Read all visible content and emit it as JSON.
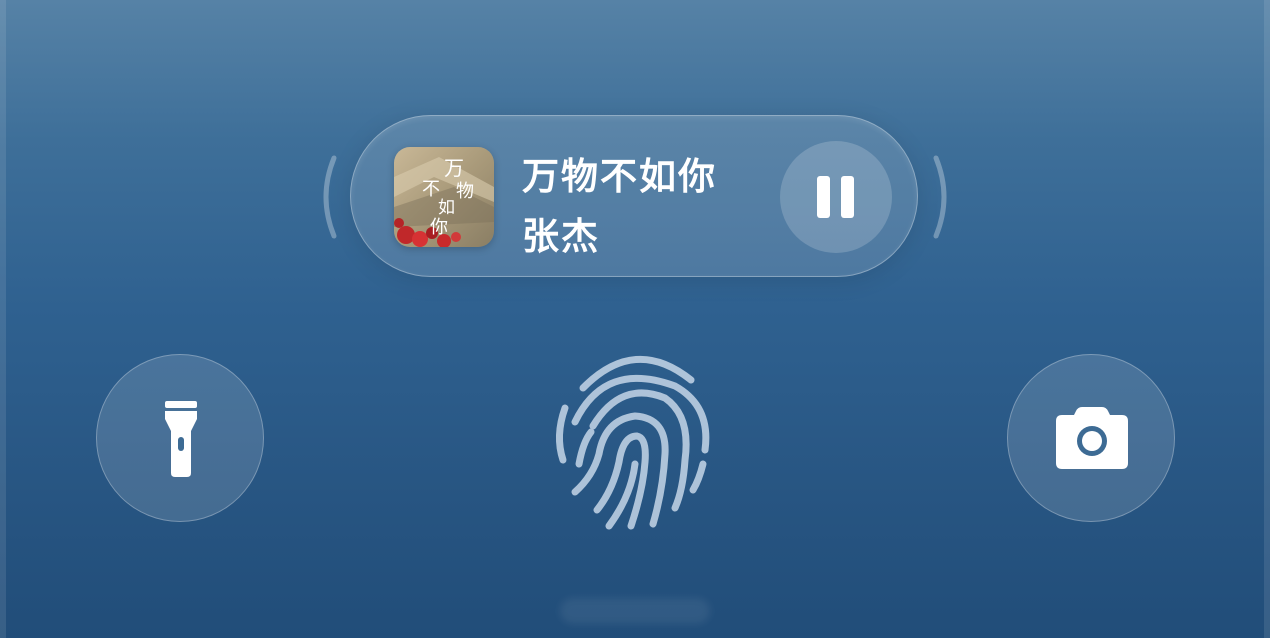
{
  "media_card": {
    "song_title": "万物不如你",
    "artist": "张杰",
    "album_cover_text": [
      "万",
      "物",
      "不",
      "如",
      "你"
    ],
    "playback_state": "playing",
    "pause_button_icon": "pause-icon"
  },
  "quick_actions": {
    "left": {
      "icon": "flashlight-icon"
    },
    "right": {
      "icon": "camera-icon"
    }
  },
  "unlock": {
    "icon": "fingerprint-icon"
  },
  "colors": {
    "background_top": "#5682a6",
    "background_bottom": "#214d79",
    "icon": "#ffffff",
    "fingerprint_stroke": "#c5d6e8"
  }
}
